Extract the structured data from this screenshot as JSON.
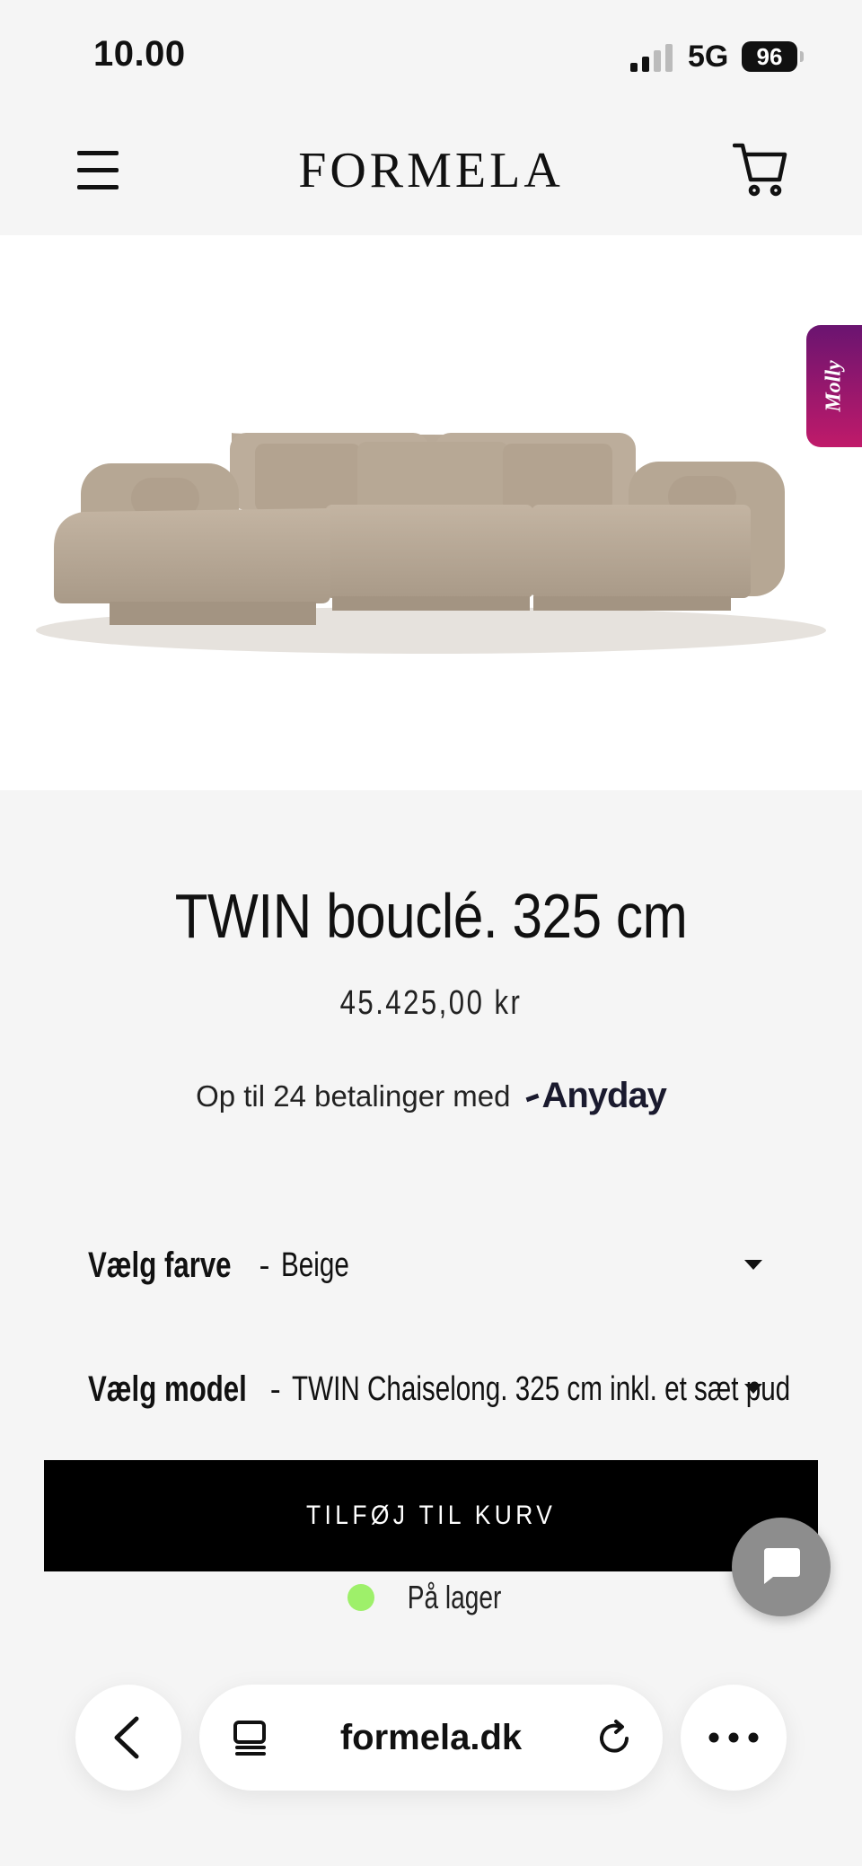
{
  "status_bar": {
    "time": "10.00",
    "network": "5G",
    "battery": "96"
  },
  "header": {
    "logo": "FORMELA"
  },
  "product": {
    "image_alt": "Beige bouclé chaiselong sofa",
    "title": "TWIN bouclé. 325 cm",
    "price": "45.425,00 kr",
    "payment_text": "Op til 24 betalinger med",
    "payment_provider": "Anyday"
  },
  "options": {
    "color": {
      "label": "Vælg farve",
      "dash": "-",
      "value": "Beige"
    },
    "model": {
      "label": "Vælg model",
      "dash": "-",
      "value": "TWIN Chaiselong. 325 cm inkl. et sæt pud"
    }
  },
  "cta": {
    "add_to_cart": "TILFØJ TIL KURV"
  },
  "stock": {
    "text": "På lager",
    "color": "#9ef06a"
  },
  "widgets": {
    "molly_label": "Molly"
  },
  "browser": {
    "url": "formela.dk"
  },
  "colors": {
    "accent": "#000000",
    "molly": "#a0186c"
  }
}
